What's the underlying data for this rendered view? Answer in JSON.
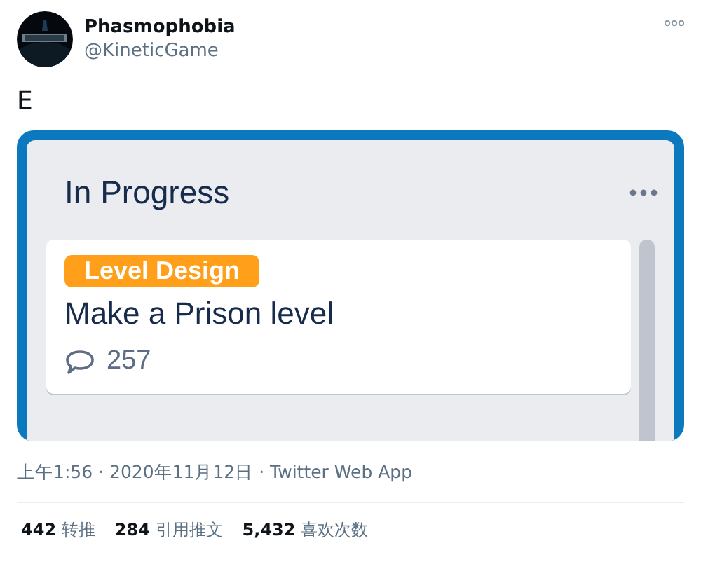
{
  "author": {
    "name": "Phasmophobia",
    "handle": "@KineticGame"
  },
  "tweet_text": "E",
  "embedded_screenshot": {
    "list_title": "In Progress",
    "card": {
      "label": {
        "text": "Level Design",
        "color": "#ff9f1a"
      },
      "title": "Make a Prison level",
      "comments": "257"
    }
  },
  "timestamp": "上午1:56 · 2020年11月12日 · Twitter Web App",
  "stats": [
    {
      "count": "442",
      "label": "转推"
    },
    {
      "count": "284",
      "label": "引用推文"
    },
    {
      "count": "5,432",
      "label": "喜欢次数"
    }
  ]
}
